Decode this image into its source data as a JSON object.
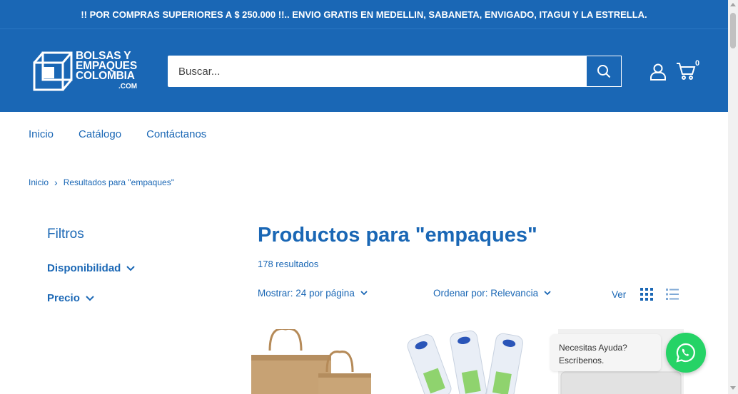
{
  "announcement": "!! POR COMPRAS SUPERIORES A $ 250.000 !!.. ENVIO GRATIS EN MEDELLIN, SABANETA, ENVIGADO, ITAGUI Y LA ESTRELLA.",
  "logo": {
    "line1": "BOLSAS Y",
    "line2": "EMPAQUES",
    "line3": "COLOMBIA",
    "line4": ".COM"
  },
  "search": {
    "placeholder": "Buscar..."
  },
  "cart": {
    "count": "0"
  },
  "nav": {
    "items": [
      "Inicio",
      "Catálogo",
      "Contáctanos"
    ]
  },
  "breadcrumb": {
    "home": "Inicio",
    "separator": "›",
    "current": "Resultados para \"empaques\""
  },
  "filters": {
    "title": "Filtros",
    "items": [
      "Disponibilidad",
      "Precio"
    ]
  },
  "main": {
    "title": "Productos para \"empaques\"",
    "results": "178 resultados",
    "show_label": "Mostrar: 24 por página",
    "sort_label": "Ordenar por: Relevancia",
    "view_label": "Ver"
  },
  "products": [
    {
      "image_icon": "kraft-paper-bags-image"
    },
    {
      "image_icon": "plastic-spoons-pack-image"
    },
    {
      "image_icon": "white-container-image"
    }
  ],
  "chat": {
    "line1": "Necesitas Ayuda?",
    "line2": "Escríbenos."
  },
  "colors": {
    "brand": "#1a67b5",
    "whatsapp": "#25d366"
  }
}
